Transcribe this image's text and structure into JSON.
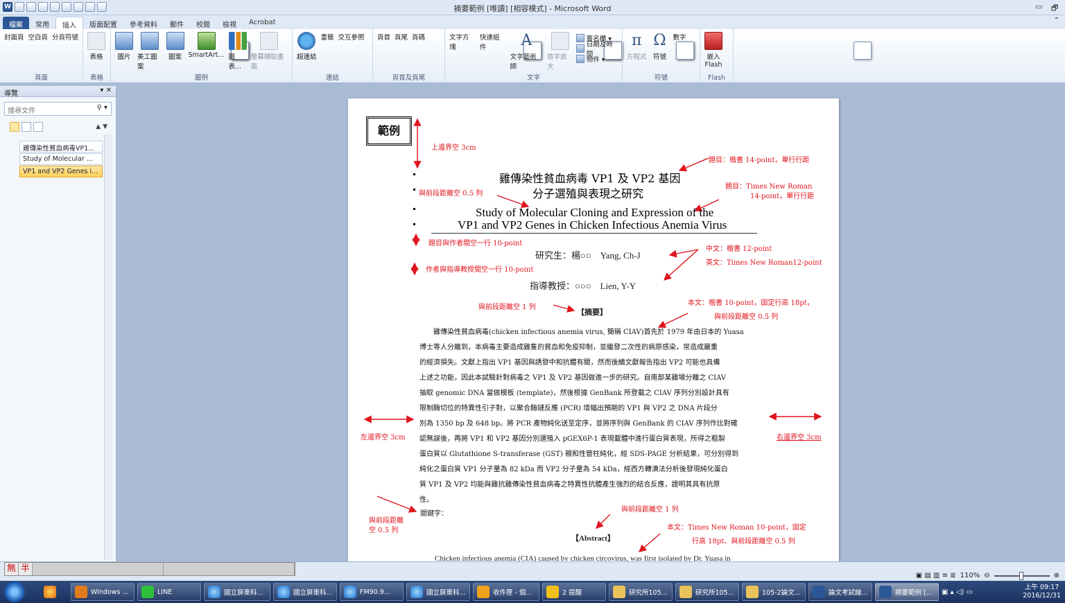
{
  "window": {
    "title": "摘要範例 [唯讀] [相容模式] - Microsoft Word",
    "min_label": "▭",
    "restore_label": "🗗",
    "help_label": "⌃"
  },
  "ribbon_tabs": [
    "檔案",
    "常用",
    "插入",
    "版面配置",
    "參考資料",
    "郵件",
    "校閱",
    "檢視",
    "Acrobat"
  ],
  "ribbon": {
    "groups": [
      {
        "name": "頁面",
        "buttons": [
          "封面頁",
          "空白頁",
          "分頁符號"
        ]
      },
      {
        "name": "表格",
        "buttons": [
          "表格"
        ]
      },
      {
        "name": "圖例",
        "buttons": [
          "圖片",
          "美工圖案",
          "圖案",
          "SmartArt...",
          "圖表...",
          "螢幕擷取畫面"
        ]
      },
      {
        "name": "連結",
        "buttons": [
          "超連結",
          "書籤",
          "交互參照"
        ]
      },
      {
        "name": "頁首及頁尾",
        "buttons": [
          "頁首",
          "頁尾",
          "頁碼"
        ]
      },
      {
        "name": "文字",
        "buttons": [
          "文字方塊",
          "快速組件",
          "文字藝術師",
          "首字放大"
        ],
        "small": [
          "簽名欄 ▾",
          "日期及時間",
          "物件 ▾"
        ]
      },
      {
        "name": "符號",
        "buttons": [
          "方程式",
          "符號",
          "數字"
        ]
      },
      {
        "name": "Flash",
        "buttons": [
          "嵌入\nFlash"
        ]
      }
    ]
  },
  "nav": {
    "title": "導覽",
    "search_placeholder": "搜尋文件",
    "items": [
      "雞傳染性貧血病毒VP1...",
      "Study of Molecular ...",
      "VP1 and VP2 Genes i..."
    ]
  },
  "doc": {
    "sample_box": "範例",
    "title_zh_1": "雞傳染性貧血病毒 VP1 及 VP2 基因",
    "title_zh_2": "分子選殖與表現之研究",
    "title_en_1": "Study of Molecular Cloning and Expression of the",
    "title_en_2": "VP1 and VP2 Genes in Chicken Infectious Anemia Virus",
    "author": "研究生：楊○○　Yang, Ch-J",
    "advisor": "指導教授：○○○　Lien, Y-Y",
    "abstract_zh_heading": "【摘要】",
    "abstract_zh_lines": [
      "　　雞傳染性貧血病毒(chicken infectious anemia virus, 簡稱 CIAV)首先於 1979 年由日本的 Yuasa",
      "博士等人分離到，本病毒主要造成雞隻的貧血和免疫抑制，並繼發二次性的病原感染，常造成嚴重",
      "的經濟損失。文獻上指出 VP1 基因與誘發中和抗體有關，然而後續文獻報告指出 VP2 可能也具備",
      "上述之功能，因此本試驗針對病毒之 VP1 及 VP2 基因做進一步的研究。自南部某雞場分離之 CIAV",
      "抽取 genomic DNA 當做模板 (template)，然後根據 GenBank 所登載之 CIAV 序列分別設計具有",
      "限制酶切位的特異性引子對，以聚合酶鏈反應 (PCR) 增幅出預期的 VP1 與 VP2 之 DNA 片段分",
      "別為 1350 bp 及 648 bp。將 PCR 產物純化送至定序，並將序列與 GenBank 的 CIAV 序列作比對確",
      "認無誤後，再將 VP1 和 VP2 基因分別選殖入 pGEX6P-1 表現載體中進行蛋白質表現，所得之粗製",
      "蛋白質以 Glutathione S-transferase (GST) 親和性管柱純化，經 SDS-PAGE 分析結果，可分別得到",
      "純化之蛋白質 VP1 分子量為 82 kDa 而 VP2 分子量為 54 kDa，經西方轉漬法分析後發現純化蛋白",
      "質 VP1 及 VP2 均能與雞抗雞傳染性貧血病毒之特異性抗體產生強烈的結合反應，證明其具有抗原",
      "性。"
    ],
    "keywords": "關鍵字：",
    "abstract_en_heading": "【Abstract】",
    "abstract_en_line": "Chicken infectious anemia (CIA) caused by chicken circovirus, was first isolated by Dr. Yuasa in"
  },
  "annotations": {
    "top_margin": "上邊界空 3cm",
    "title_font_zh": "題目：楷書 14-point，單行行距",
    "title_font_en_1": "題目：Times New Roman",
    "title_font_en_2": "14-point，單行行距",
    "before_space_05": "與前段距離空 0.5 列",
    "title_author_gap": "題目與作者間空一行 10-point",
    "zh_font": "中文：楷書 12-point",
    "en_font": "英文：Times New Roman12-point",
    "author_advisor_gap": "作者與指導教授間空一行 10-point",
    "before_space_1": "與前段距離空 1 列",
    "body_font": "本文：楷書 10-point，固定行高 18pt，",
    "before_space_05b": "與前段距離空 0.5 列",
    "left_margin": "左邊界空 3cm",
    "right_margin": "右邊界空 3cm",
    "before_space_05c_1": "與前段距離",
    "before_space_05c_2": "空 0.5 列",
    "before_space_1b": "與前段距離空 1 列",
    "abstract_en_font_1": "本文：Times New Roman 10-point，固定",
    "abstract_en_font_2": "行高 18pt、與前段距離空 0.5 列"
  },
  "status": {
    "ime_1": "無",
    "ime_2": "半",
    "zoom": "110%"
  },
  "taskbar": {
    "items": [
      "",
      "Windows ...",
      "LINE",
      "國立屏東科...",
      "國立屏東科...",
      "FM90.9...",
      "國立屏東科...",
      "收件匣 - 個...",
      "2 提醒",
      "研究所105...",
      "研究所105...",
      "105-2論文...",
      "論文考試線...",
      "摘要範例 [..."
    ],
    "time": "上午 09:17",
    "date": "2016/12/31"
  },
  "colors": {
    "accent": "#2b5797",
    "annotation": "#e0151e"
  }
}
